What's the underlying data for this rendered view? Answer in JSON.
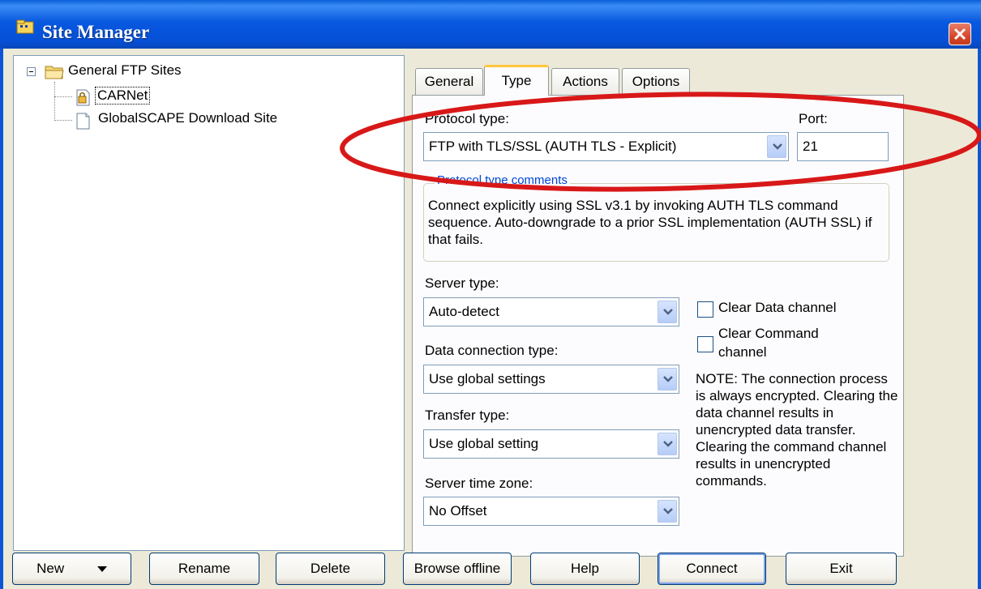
{
  "window": {
    "title": "Site Manager"
  },
  "tree": {
    "root_label": "General FTP Sites",
    "items": [
      {
        "label": "CARNet",
        "selected": true
      },
      {
        "label": "GlobalSCAPE Download Site",
        "selected": false
      }
    ]
  },
  "tabs": [
    {
      "label": "General",
      "active": false
    },
    {
      "label": "Type",
      "active": true
    },
    {
      "label": "Actions",
      "active": false
    },
    {
      "label": "Options",
      "active": false
    }
  ],
  "type_tab": {
    "protocol_label": "Protocol type:",
    "protocol_value": "FTP with TLS/SSL (AUTH TLS - Explicit)",
    "port_label": "Port:",
    "port_value": "21",
    "comments_title": "Protocol type comments",
    "comments_text": "Connect explicitly using SSL v3.1 by invoking AUTH TLS command sequence. Auto-downgrade to a prior SSL implementation (AUTH SSL) if that fails.",
    "server_type_label": "Server type:",
    "server_type_value": "Auto-detect",
    "data_conn_label": "Data connection type:",
    "data_conn_value": "Use global settings",
    "transfer_label": "Transfer type:",
    "transfer_value": "Use global setting",
    "timezone_label": "Server time zone:",
    "timezone_value": "No Offset",
    "clear_data_label": "Clear Data channel",
    "clear_data_checked": false,
    "clear_cmd_label_1": "Clear Command",
    "clear_cmd_label_2": "channel",
    "clear_cmd_checked": false,
    "note": "NOTE: The connection process is always encrypted.  Clearing the data channel results in unencrypted data transfer. Clearing the command channel results in unencrypted commands."
  },
  "buttons": {
    "new": "New",
    "rename": "Rename",
    "delete": "Delete",
    "browse_offline": "Browse offline",
    "help": "Help",
    "connect": "Connect",
    "exit": "Exit"
  },
  "colors": {
    "titlebar": "#0858e0",
    "window_bg": "#ece9d8",
    "highlight_oval": "#d81818",
    "active_tab_accent": "#ffc83c"
  }
}
